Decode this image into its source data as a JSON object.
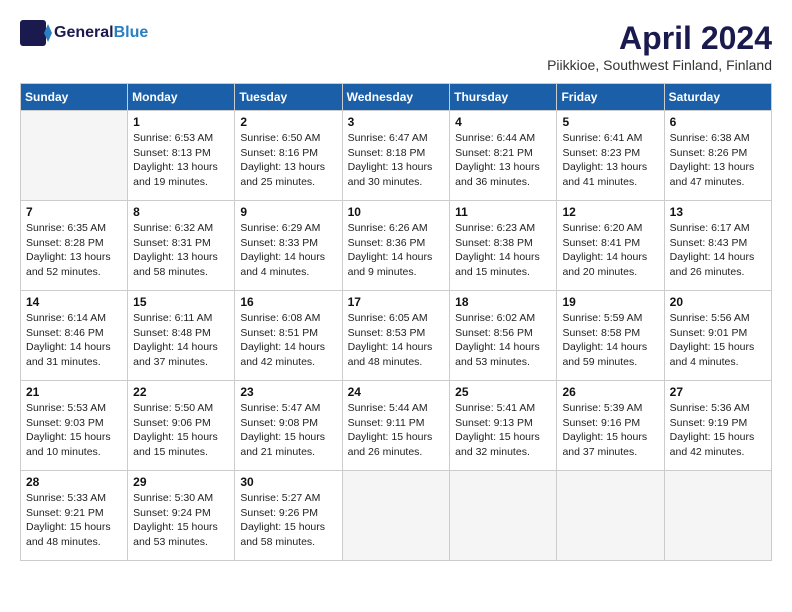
{
  "header": {
    "logo_general": "General",
    "logo_blue": "Blue",
    "month": "April 2024",
    "location": "Piikkioe, Southwest Finland, Finland"
  },
  "weekdays": [
    "Sunday",
    "Monday",
    "Tuesday",
    "Wednesday",
    "Thursday",
    "Friday",
    "Saturday"
  ],
  "weeks": [
    [
      {
        "day": "",
        "info": ""
      },
      {
        "day": "1",
        "info": "Sunrise: 6:53 AM\nSunset: 8:13 PM\nDaylight: 13 hours\nand 19 minutes."
      },
      {
        "day": "2",
        "info": "Sunrise: 6:50 AM\nSunset: 8:16 PM\nDaylight: 13 hours\nand 25 minutes."
      },
      {
        "day": "3",
        "info": "Sunrise: 6:47 AM\nSunset: 8:18 PM\nDaylight: 13 hours\nand 30 minutes."
      },
      {
        "day": "4",
        "info": "Sunrise: 6:44 AM\nSunset: 8:21 PM\nDaylight: 13 hours\nand 36 minutes."
      },
      {
        "day": "5",
        "info": "Sunrise: 6:41 AM\nSunset: 8:23 PM\nDaylight: 13 hours\nand 41 minutes."
      },
      {
        "day": "6",
        "info": "Sunrise: 6:38 AM\nSunset: 8:26 PM\nDaylight: 13 hours\nand 47 minutes."
      }
    ],
    [
      {
        "day": "7",
        "info": "Sunrise: 6:35 AM\nSunset: 8:28 PM\nDaylight: 13 hours\nand 52 minutes."
      },
      {
        "day": "8",
        "info": "Sunrise: 6:32 AM\nSunset: 8:31 PM\nDaylight: 13 hours\nand 58 minutes."
      },
      {
        "day": "9",
        "info": "Sunrise: 6:29 AM\nSunset: 8:33 PM\nDaylight: 14 hours\nand 4 minutes."
      },
      {
        "day": "10",
        "info": "Sunrise: 6:26 AM\nSunset: 8:36 PM\nDaylight: 14 hours\nand 9 minutes."
      },
      {
        "day": "11",
        "info": "Sunrise: 6:23 AM\nSunset: 8:38 PM\nDaylight: 14 hours\nand 15 minutes."
      },
      {
        "day": "12",
        "info": "Sunrise: 6:20 AM\nSunset: 8:41 PM\nDaylight: 14 hours\nand 20 minutes."
      },
      {
        "day": "13",
        "info": "Sunrise: 6:17 AM\nSunset: 8:43 PM\nDaylight: 14 hours\nand 26 minutes."
      }
    ],
    [
      {
        "day": "14",
        "info": "Sunrise: 6:14 AM\nSunset: 8:46 PM\nDaylight: 14 hours\nand 31 minutes."
      },
      {
        "day": "15",
        "info": "Sunrise: 6:11 AM\nSunset: 8:48 PM\nDaylight: 14 hours\nand 37 minutes."
      },
      {
        "day": "16",
        "info": "Sunrise: 6:08 AM\nSunset: 8:51 PM\nDaylight: 14 hours\nand 42 minutes."
      },
      {
        "day": "17",
        "info": "Sunrise: 6:05 AM\nSunset: 8:53 PM\nDaylight: 14 hours\nand 48 minutes."
      },
      {
        "day": "18",
        "info": "Sunrise: 6:02 AM\nSunset: 8:56 PM\nDaylight: 14 hours\nand 53 minutes."
      },
      {
        "day": "19",
        "info": "Sunrise: 5:59 AM\nSunset: 8:58 PM\nDaylight: 14 hours\nand 59 minutes."
      },
      {
        "day": "20",
        "info": "Sunrise: 5:56 AM\nSunset: 9:01 PM\nDaylight: 15 hours\nand 4 minutes."
      }
    ],
    [
      {
        "day": "21",
        "info": "Sunrise: 5:53 AM\nSunset: 9:03 PM\nDaylight: 15 hours\nand 10 minutes."
      },
      {
        "day": "22",
        "info": "Sunrise: 5:50 AM\nSunset: 9:06 PM\nDaylight: 15 hours\nand 15 minutes."
      },
      {
        "day": "23",
        "info": "Sunrise: 5:47 AM\nSunset: 9:08 PM\nDaylight: 15 hours\nand 21 minutes."
      },
      {
        "day": "24",
        "info": "Sunrise: 5:44 AM\nSunset: 9:11 PM\nDaylight: 15 hours\nand 26 minutes."
      },
      {
        "day": "25",
        "info": "Sunrise: 5:41 AM\nSunset: 9:13 PM\nDaylight: 15 hours\nand 32 minutes."
      },
      {
        "day": "26",
        "info": "Sunrise: 5:39 AM\nSunset: 9:16 PM\nDaylight: 15 hours\nand 37 minutes."
      },
      {
        "day": "27",
        "info": "Sunrise: 5:36 AM\nSunset: 9:19 PM\nDaylight: 15 hours\nand 42 minutes."
      }
    ],
    [
      {
        "day": "28",
        "info": "Sunrise: 5:33 AM\nSunset: 9:21 PM\nDaylight: 15 hours\nand 48 minutes."
      },
      {
        "day": "29",
        "info": "Sunrise: 5:30 AM\nSunset: 9:24 PM\nDaylight: 15 hours\nand 53 minutes."
      },
      {
        "day": "30",
        "info": "Sunrise: 5:27 AM\nSunset: 9:26 PM\nDaylight: 15 hours\nand 58 minutes."
      },
      {
        "day": "",
        "info": ""
      },
      {
        "day": "",
        "info": ""
      },
      {
        "day": "",
        "info": ""
      },
      {
        "day": "",
        "info": ""
      }
    ]
  ]
}
